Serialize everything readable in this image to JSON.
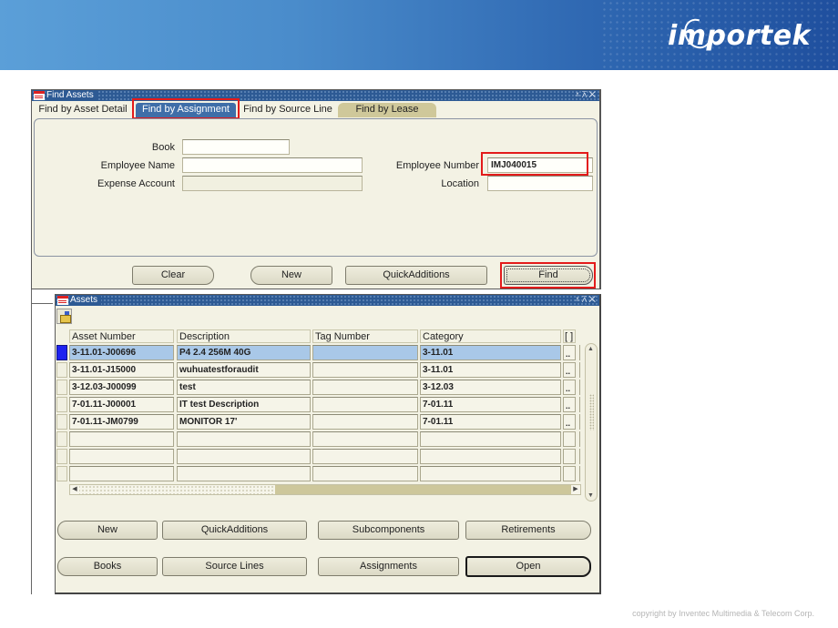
{
  "banner": {
    "logo_text": "importek"
  },
  "find_window": {
    "title": "Find Assets",
    "window_controls": "≚ ⊼ ✕",
    "tabs": [
      {
        "label": "Find by Asset Detail",
        "active": false
      },
      {
        "label": "Find by Assignment",
        "active": true
      },
      {
        "label": "Find by Source Line",
        "active": false
      },
      {
        "label": "Find by Lease",
        "active": false
      }
    ],
    "fields": {
      "book": {
        "label": "Book",
        "value": ""
      },
      "employee_name": {
        "label": "Employee Name",
        "value": ""
      },
      "expense_account": {
        "label": "Expense Account",
        "value": ""
      },
      "employee_number": {
        "label": "Employee Number",
        "value": "IMJ040015"
      },
      "location": {
        "label": "Location",
        "value": ""
      }
    },
    "buttons": {
      "clear": "Clear",
      "new": "New",
      "quick_additions": "QuickAdditions",
      "find": "Find"
    }
  },
  "assets_window": {
    "title": "Assets",
    "window_controls": "≚ ⊼ ✕",
    "columns": [
      "Asset Number",
      "Description",
      "Tag Number",
      "Category",
      "[ ]"
    ],
    "rows": [
      {
        "asset_number": "3-11.01-J00696",
        "description": "P4 2.4 256M 40G",
        "tag_number": "",
        "category": "3-11.01",
        "lov": "..",
        "selected": true
      },
      {
        "asset_number": "3-11.01-J15000",
        "description": "wuhuatestforaudit",
        "tag_number": "",
        "category": "3-11.01",
        "lov": "..",
        "selected": false
      },
      {
        "asset_number": "3-12.03-J00099",
        "description": "test",
        "tag_number": "",
        "category": "3-12.03",
        "lov": "..",
        "selected": false
      },
      {
        "asset_number": "7-01.11-J00001",
        "description": "IT test Description",
        "tag_number": "",
        "category": "7-01.11",
        "lov": "..",
        "selected": false
      },
      {
        "asset_number": "7-01.11-JM0799",
        "description": "MONITOR 17'",
        "tag_number": "",
        "category": "7-01.11",
        "lov": "..",
        "selected": false
      },
      {
        "asset_number": "",
        "description": "",
        "tag_number": "",
        "category": "",
        "lov": "",
        "selected": false
      },
      {
        "asset_number": "",
        "description": "",
        "tag_number": "",
        "category": "",
        "lov": "",
        "selected": false
      },
      {
        "asset_number": "",
        "description": "",
        "tag_number": "",
        "category": "",
        "lov": "",
        "selected": false
      }
    ],
    "buttons": {
      "new": "New",
      "quick_additions": "QuickAdditions",
      "subcomponents": "Subcomponents",
      "retirements": "Retirements",
      "books": "Books",
      "source_lines": "Source Lines",
      "assignments": "Assignments",
      "open": "Open"
    }
  },
  "footer": {
    "copyright": "copyright by Inventec Multimedia & Telecom Corp."
  }
}
